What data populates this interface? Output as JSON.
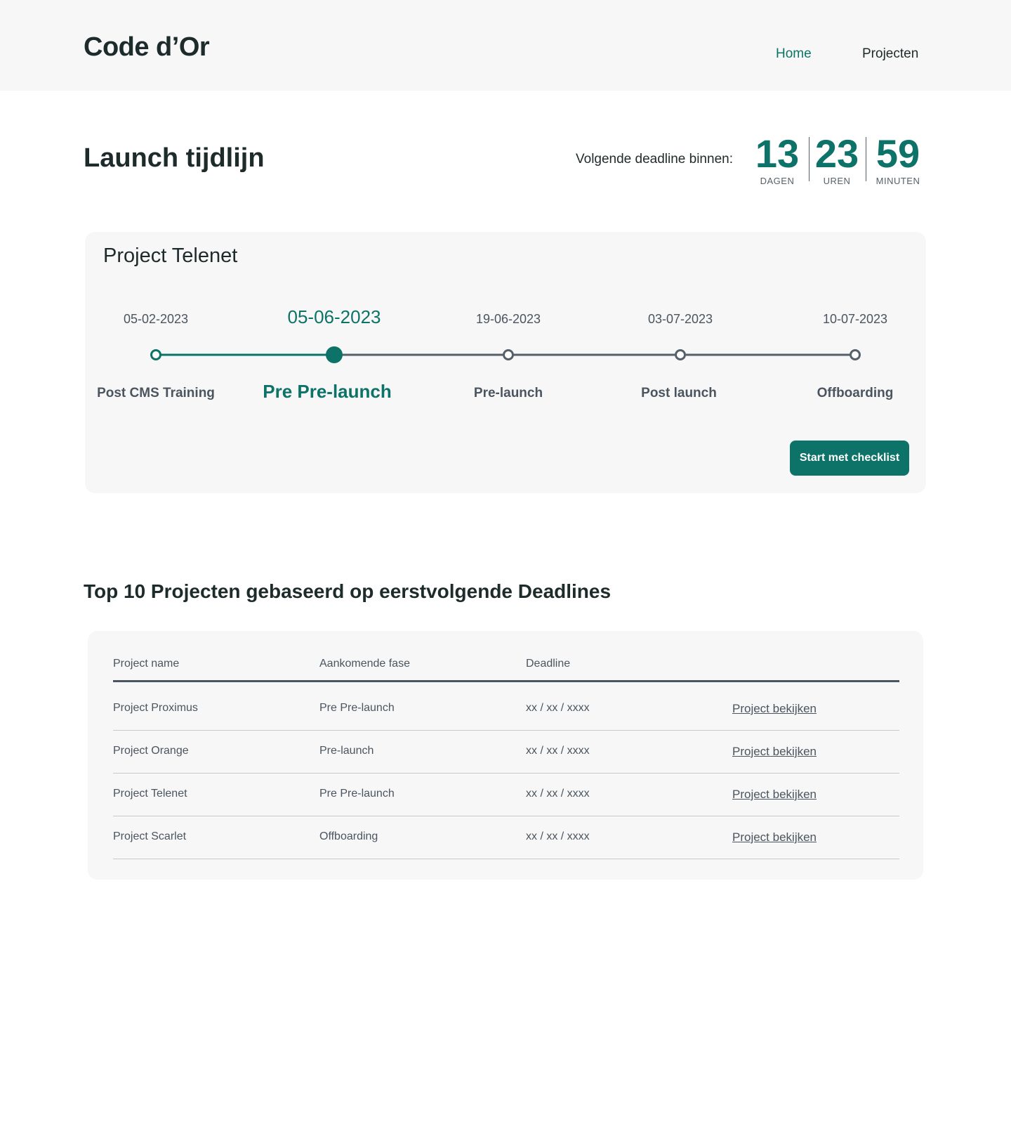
{
  "header": {
    "logo": "Code d’Or",
    "nav": [
      {
        "label": "Home",
        "active": true
      },
      {
        "label": "Projecten",
        "active": false
      }
    ]
  },
  "page": {
    "title": "Launch tijdlijn"
  },
  "countdown": {
    "label": "Volgende deadline binnen:",
    "days": {
      "value": "13",
      "caption": "DAGEN"
    },
    "hours": {
      "value": "23",
      "caption": "UREN"
    },
    "minutes": {
      "value": "59",
      "caption": "MINUTEN"
    }
  },
  "timeline": {
    "project_title": "Project Telenet",
    "current_index": 1,
    "milestones": [
      {
        "date": "05-02-2023",
        "phase": "Post CMS Training"
      },
      {
        "date": "05-06-2023",
        "phase": "Pre Pre-launch"
      },
      {
        "date": "19-06-2023",
        "phase": "Pre-launch"
      },
      {
        "date": "03-07-2023",
        "phase": "Post launch"
      },
      {
        "date": "10-07-2023",
        "phase": "Offboarding"
      }
    ],
    "button_label": "Start met checklist",
    "colors": {
      "accent": "#0d7369",
      "muted": "#55606b"
    }
  },
  "projects_section": {
    "title": "Top 10 Projecten gebaseerd op eerstvolgende Deadlines",
    "columns": [
      "Project name",
      "Aankomende fase",
      "Deadline"
    ],
    "rows": [
      {
        "name": "Project Proximus",
        "phase": "Pre Pre-launch",
        "deadline": "xx / xx / xxxx",
        "link": "Project bekijken"
      },
      {
        "name": "Project Orange",
        "phase": "Pre-launch",
        "deadline": "xx / xx / xxxx",
        "link": "Project bekijken"
      },
      {
        "name": "Project Telenet",
        "phase": "Pre Pre-launch",
        "deadline": "xx / xx / xxxx",
        "link": "Project bekijken"
      },
      {
        "name": "Project Scarlet",
        "phase": "Offboarding",
        "deadline": "xx / xx / xxxx",
        "link": "Project bekijken"
      }
    ]
  }
}
